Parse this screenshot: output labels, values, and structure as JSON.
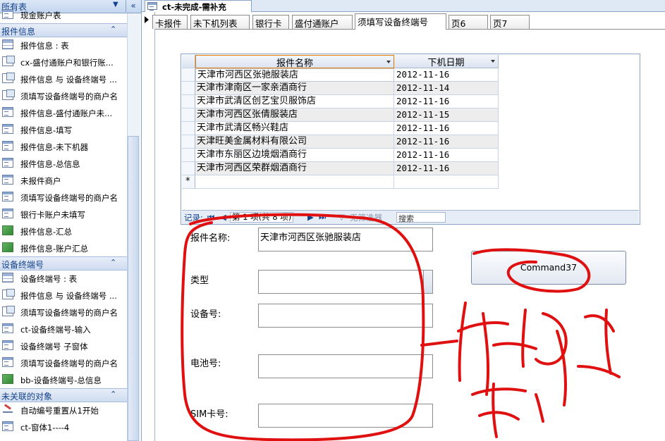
{
  "nav": {
    "header_title": "所有表",
    "header_chevron": "«",
    "top_item": "现金账户表",
    "groups": [
      {
        "label": "报件信息",
        "items": [
          {
            "label": "报件信息 : 表",
            "icon": "table-icon"
          },
          {
            "label": "cx-盛付通账户和银行账...",
            "icon": "query-icon"
          },
          {
            "label": "报件信息 与 设备终端号 ...",
            "icon": "query-icon"
          },
          {
            "label": "须填写设备终端号的商户名",
            "icon": "query-icon"
          },
          {
            "label": "报件信息-盛付通账户未...",
            "icon": "form-icon"
          },
          {
            "label": "报件信息-填写",
            "icon": "form-icon"
          },
          {
            "label": "报件信息-未下机器",
            "icon": "form-icon"
          },
          {
            "label": "报件信息-总信息",
            "icon": "form-icon"
          },
          {
            "label": "未报件商户",
            "icon": "form-icon"
          },
          {
            "label": "须填写设备终端号的商户名",
            "icon": "form-icon"
          },
          {
            "label": "银行卡账户未填写",
            "icon": "form-icon"
          },
          {
            "label": "报件信息-汇总",
            "icon": "report-icon"
          },
          {
            "label": "报件信息-账户汇总",
            "icon": "report-icon"
          }
        ]
      },
      {
        "label": "设备终端号",
        "items": [
          {
            "label": "设备终端号 : 表",
            "icon": "table-icon"
          },
          {
            "label": "报件信息 与 设备终端号 ...",
            "icon": "query-icon"
          },
          {
            "label": "须填写设备终端号的商户名",
            "icon": "query-icon"
          },
          {
            "label": "ct-设备终端号-输入",
            "icon": "form-icon"
          },
          {
            "label": "设备终端号 子窗体",
            "icon": "form-icon"
          },
          {
            "label": "须填写设备终端号的商户名",
            "icon": "form-icon"
          },
          {
            "label": "bb-设备终端号-总信息",
            "icon": "report-icon"
          }
        ]
      },
      {
        "label": "未关联的对象",
        "items": [
          {
            "label": "自动编号重置从1开始",
            "icon": "macro-icon"
          },
          {
            "label": "ct-窗体1----4",
            "icon": "form-icon"
          }
        ]
      }
    ]
  },
  "document": {
    "tab_title": "ct-未完成-需补充",
    "tabs": [
      "卡报件",
      "未下机列表",
      "银行卡",
      "盛付通账户",
      "须填写设备终端号",
      "页6",
      "页7"
    ],
    "active_tab": 4
  },
  "datasheet": {
    "columns": [
      "报件名称",
      "下机日期"
    ],
    "rows": [
      [
        "天津市河西区张驰服装店",
        "2012-11-16"
      ],
      [
        "天津市津南区一家亲酒商行",
        "2012-11-14"
      ],
      [
        "天津市武清区创艺宝贝服饰店",
        "2012-11-16"
      ],
      [
        "天津市河西区张倩服装店",
        "2012-11-15"
      ],
      [
        "天津市武清区畅兴鞋店",
        "2012-11-16"
      ],
      [
        "天津旺美金属材料有限公司",
        "2012-11-16"
      ],
      [
        "天津市东丽区边境烟酒商行",
        "2012-11-16"
      ],
      [
        "天津市河西区荣群烟酒商行",
        "2012-11-16"
      ]
    ],
    "new_row_marker": "*",
    "nav": {
      "record_label": "记录:",
      "first": "⏮",
      "prev": "◀",
      "position": "第 1 项(共 8 项)",
      "next": "▶",
      "last": "⏭",
      "filter": "无筛选器",
      "search": "搜索"
    }
  },
  "form": {
    "labels": {
      "name": "报件名称:",
      "type": "类型",
      "device": "设备号:",
      "battery": "电池号:",
      "sim": "SIM卡号:"
    },
    "values": {
      "name": "天津市河西区张驰服装店",
      "type": "",
      "device": "",
      "battery": "",
      "sim": ""
    },
    "command_button": "Command37"
  },
  "colors": {
    "ink": "#e01010",
    "accent": "#15428b",
    "selection_border": "#e07b00"
  }
}
